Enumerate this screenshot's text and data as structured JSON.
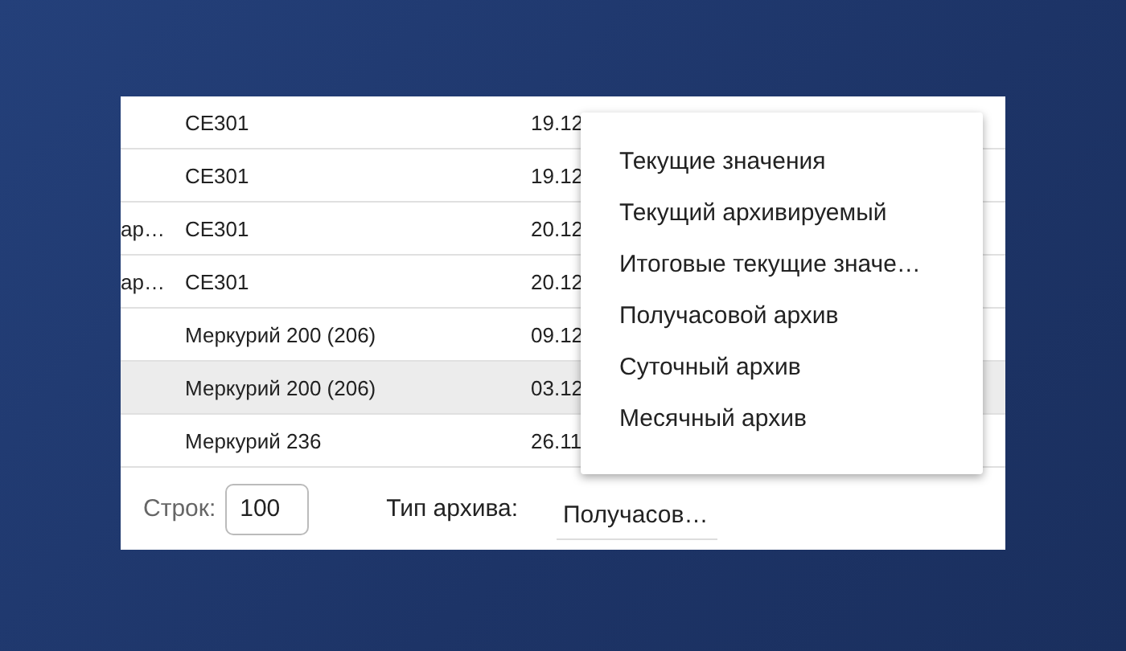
{
  "table": {
    "rows": [
      {
        "cells": [
          "",
          "CE301",
          "19.12"
        ],
        "selected": false
      },
      {
        "cells": [
          "",
          "CE301",
          "19.12"
        ],
        "selected": false
      },
      {
        "cells": [
          "ар…",
          "CE301",
          "20.12"
        ],
        "selected": false
      },
      {
        "cells": [
          "ар…",
          "CE301",
          "20.12"
        ],
        "selected": false
      },
      {
        "cells": [
          "",
          "Меркурий 200 (206)",
          "09.12"
        ],
        "selected": false
      },
      {
        "cells": [
          "",
          "Меркурий 200 (206)",
          "03.12"
        ],
        "selected": true
      },
      {
        "cells": [
          "",
          "Меркурий 236",
          "26.11"
        ],
        "selected": false
      }
    ]
  },
  "footer": {
    "rows_label": "Строк:",
    "rows_value": "100",
    "archive_label": "Тип архива:",
    "archive_value": "Получасов…"
  },
  "menu": {
    "items": [
      {
        "label": "Текущие значения"
      },
      {
        "label": "Текущий архивируемый"
      },
      {
        "label": "Итоговые текущие значе…"
      },
      {
        "label": "Получасовой архив"
      },
      {
        "label": "Суточный архив"
      },
      {
        "label": "Месячный архив"
      }
    ]
  }
}
